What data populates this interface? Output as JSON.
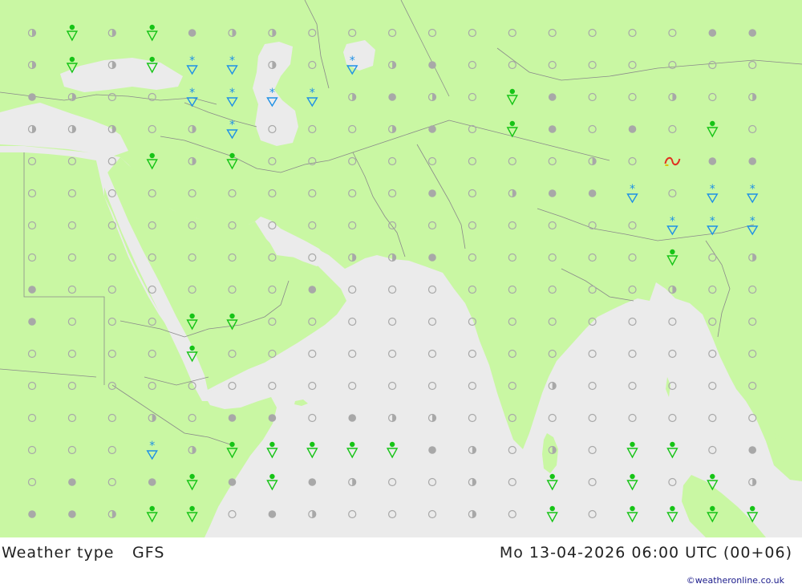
{
  "footer": {
    "title": "Weather type",
    "model": "GFS",
    "valid_time": "Mo 13-04-2026 06:00 UTC (00+06)",
    "credit": "©weatheronline.co.uk"
  },
  "colors": {
    "land": "#c9f7a3",
    "sea": "#ebebeb",
    "border": "#8a8a8a",
    "symbol_gray": "#a8a8a8",
    "rain_green": "#16c416",
    "snow_blue": "#1e90e6",
    "thunder_red": "#e03020",
    "thunder_yellow": "#e0c000"
  },
  "grid": {
    "cols": 19,
    "rows": 16,
    "rows_codes": [
      "HRHRFHHCCCCCCCCCCFF",
      "HRHRSSHCSHFCCCCCCCC",
      "FHCCSSSSHFHCRFCCHCH",
      "HHHCHSCCCHFCRFCFCRC",
      "CCCRHRCCCCCCCCHCTFF",
      "CCCCCCCCCCFCHFFSCSS",
      "CCCCCCCCCCCCCCCCSSS",
      "CCCCCCCCHHFCCCCCRCH",
      "FCCCCCCFCCCCCCCCHCC",
      "FCCCRRCCCCCCCCCCCCC",
      "CCCCRCCCCCCCCCCCCCC",
      "CCCCCCCCCCCCCHCCCCC",
      "CCCHCFFCFHHCCCCCCCC",
      "CCCSHRRRRRFHCHCRRCF",
      "CFCFRFRFHCCHCRCRCRH",
      "FFHRRCFHCCCHCRCRRRR"
    ],
    "legend_codes": {
      "C": "clear",
      "H": "partly-cloudy",
      "F": "overcast",
      "R": "rain-shower",
      "S": "sleet",
      "T": "thunderstorm"
    }
  }
}
